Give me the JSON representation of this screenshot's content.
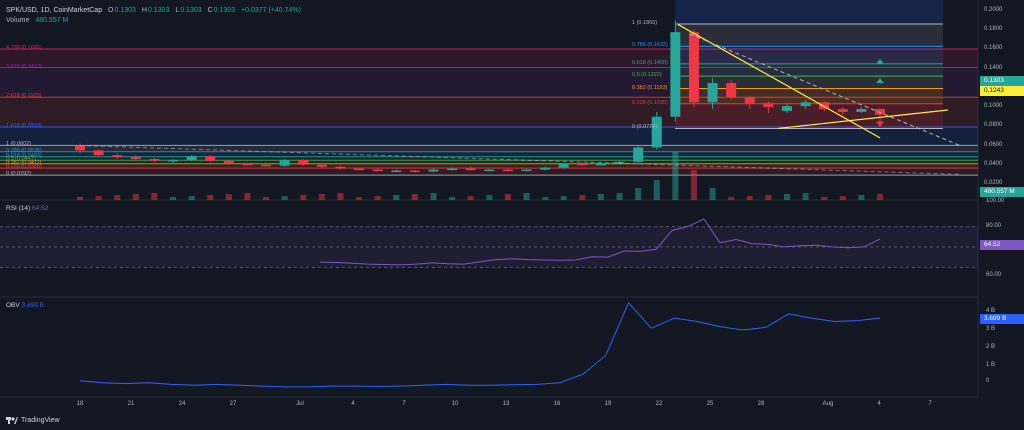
{
  "header": {
    "symbol": "SPK/USD, 1D, CoinMarketCap",
    "o_label": "O",
    "o_value": "0.1303",
    "h_label": "H",
    "h_value": "0.1303",
    "l_label": "L",
    "l_value": "0.1303",
    "c_label": "C",
    "c_value": "0.1303",
    "change": "+0.0377 (+40.74%)",
    "volume_label": "Volume",
    "volume_value": "480.557 M"
  },
  "fib_ext_levels": [
    {
      "label": "4.236 (0.1605)",
      "color": "#e91e63"
    },
    {
      "label": "3.618 (0.1412)",
      "color": "#9c27b0"
    },
    {
      "label": "2.618 (0.1103)",
      "color": "#f23645"
    },
    {
      "label": "1.618 (0.0793)",
      "color": "#2962ff"
    },
    {
      "label": "1 (0.0602)",
      "color": "#b2b5be"
    },
    {
      "label": "0.786 (0.0536)",
      "color": "#2196f3"
    },
    {
      "label": "0.618 (0.0483)",
      "color": "#26a69a"
    },
    {
      "label": "0.5 (0.0447)",
      "color": "#4caf50"
    },
    {
      "label": "0.382 (0.0411)",
      "color": "#ff9800"
    },
    {
      "label": "0.236 (0.0365)",
      "color": "#f23645"
    },
    {
      "label": "0 (0.0292)",
      "color": "#b2b5be"
    }
  ],
  "fib_retr_levels": [
    {
      "label": "1 (0.1865)",
      "color": "#b2b5be"
    },
    {
      "label": "0.786 (0.1632)",
      "color": "#2196f3"
    },
    {
      "label": "0.618 (0.1450)",
      "color": "#26a69a"
    },
    {
      "label": "0.5 (0.1322)",
      "color": "#4caf50"
    },
    {
      "label": "0.382 (0.1193)",
      "color": "#ff9800"
    },
    {
      "label": "0.236 (0.1035)",
      "color": "#f23645"
    },
    {
      "label": "0 (0.0778)",
      "color": "#b2b5be"
    }
  ],
  "price_axis": [
    "0.2000",
    "0.1800",
    "0.1600",
    "0.1400",
    "0.1200",
    "0.1000",
    "0.0800",
    "0.0600",
    "0.0400",
    "0.0200"
  ],
  "price_tags": {
    "last": "0.1303",
    "last_color": "#26a69a",
    "level": "0.1243",
    "level_color": "#ffeb3b",
    "volume": "480.557 M",
    "volume_color": "#26a69a",
    "volume_axis_label": "100.00"
  },
  "rsi": {
    "title": "RSI (14)",
    "value": "64.52",
    "axis": [
      "80.00",
      "60.00"
    ],
    "color": "#7e57c2",
    "series": [
      36.5,
      36.0,
      35.0,
      34.0,
      33.5,
      33.0,
      34.0,
      35.5,
      34.5,
      34.0,
      37.0,
      39.5,
      40.5,
      39.5,
      39.0,
      38.8,
      39.0,
      43.0,
      42.5,
      50.0,
      49.5,
      52.0,
      75.0,
      80.0,
      89.0,
      60.0,
      64.0,
      59.0,
      58.0,
      55.0,
      56.5,
      57.0,
      55.0,
      54.0,
      55.0,
      64.52
    ]
  },
  "obv": {
    "title": "OBV",
    "value": "3.699 B",
    "axis": [
      "4 B",
      "3 B",
      "2 B",
      "1 B",
      "0"
    ],
    "color": "#2962ff",
    "series": [
      0.02,
      -0.1,
      -0.15,
      -0.1,
      -0.2,
      -0.25,
      -0.2,
      -0.25,
      -0.3,
      -0.35,
      -0.35,
      -0.3,
      -0.3,
      -0.32,
      -0.3,
      -0.25,
      -0.2,
      -0.25,
      -0.25,
      -0.22,
      -0.2,
      -0.1,
      0.4,
      1.5,
      4.6,
      3.1,
      3.7,
      3.5,
      3.2,
      3.0,
      3.15,
      3.95,
      3.7,
      3.5,
      3.55,
      3.699
    ]
  },
  "x_axis": [
    "18",
    "21",
    "24",
    "27",
    "Jul",
    "4",
    "7",
    "10",
    "13",
    "16",
    "19",
    "22",
    "25",
    "28",
    "Aug",
    "4",
    "7"
  ],
  "candles": [
    [
      0.06,
      0.062,
      0.052,
      0.055
    ],
    [
      0.055,
      0.056,
      0.049,
      0.05
    ],
    [
      0.05,
      0.052,
      0.046,
      0.048
    ],
    [
      0.048,
      0.05,
      0.044,
      0.046
    ],
    [
      0.046,
      0.047,
      0.043,
      0.044
    ],
    [
      0.044,
      0.046,
      0.042,
      0.045
    ],
    [
      0.045,
      0.05,
      0.044,
      0.049
    ],
    [
      0.049,
      0.05,
      0.043,
      0.044
    ],
    [
      0.044,
      0.045,
      0.04,
      0.041
    ],
    [
      0.041,
      0.042,
      0.039,
      0.04
    ],
    [
      0.04,
      0.041,
      0.038,
      0.039
    ],
    [
      0.039,
      0.046,
      0.038,
      0.045
    ],
    [
      0.045,
      0.046,
      0.039,
      0.04
    ],
    [
      0.04,
      0.041,
      0.037,
      0.038
    ],
    [
      0.038,
      0.039,
      0.035,
      0.036
    ],
    [
      0.036,
      0.037,
      0.034,
      0.035
    ],
    [
      0.035,
      0.036,
      0.033,
      0.034
    ],
    [
      0.034,
      0.035,
      0.033,
      0.034
    ],
    [
      0.034,
      0.035,
      0.032,
      0.033
    ],
    [
      0.033,
      0.036,
      0.032,
      0.035
    ],
    [
      0.035,
      0.037,
      0.034,
      0.036
    ],
    [
      0.036,
      0.038,
      0.034,
      0.035
    ],
    [
      0.035,
      0.036,
      0.034,
      0.035
    ],
    [
      0.035,
      0.036,
      0.034,
      0.034
    ],
    [
      0.034,
      0.036,
      0.033,
      0.035
    ],
    [
      0.035,
      0.038,
      0.034,
      0.037
    ],
    [
      0.037,
      0.042,
      0.036,
      0.041
    ],
    [
      0.041,
      0.043,
      0.039,
      0.04
    ],
    [
      0.04,
      0.042,
      0.039,
      0.041
    ],
    [
      0.041,
      0.044,
      0.04,
      0.043
    ],
    [
      0.043,
      0.06,
      0.042,
      0.058
    ],
    [
      0.058,
      0.095,
      0.056,
      0.09
    ],
    [
      0.09,
      0.19,
      0.085,
      0.178
    ],
    [
      0.178,
      0.18,
      0.1,
      0.105
    ],
    [
      0.105,
      0.13,
      0.098,
      0.125
    ],
    [
      0.125,
      0.128,
      0.108,
      0.11
    ],
    [
      0.11,
      0.112,
      0.098,
      0.104
    ],
    [
      0.104,
      0.106,
      0.094,
      0.1
    ],
    [
      0.096,
      0.104,
      0.094,
      0.101
    ],
    [
      0.101,
      0.108,
      0.098,
      0.105
    ],
    [
      0.105,
      0.106,
      0.096,
      0.098
    ],
    [
      0.098,
      0.1,
      0.092,
      0.095
    ],
    [
      0.095,
      0.1,
      0.094,
      0.098
    ],
    [
      0.098,
      0.099,
      0.085,
      0.092
    ]
  ]
}
